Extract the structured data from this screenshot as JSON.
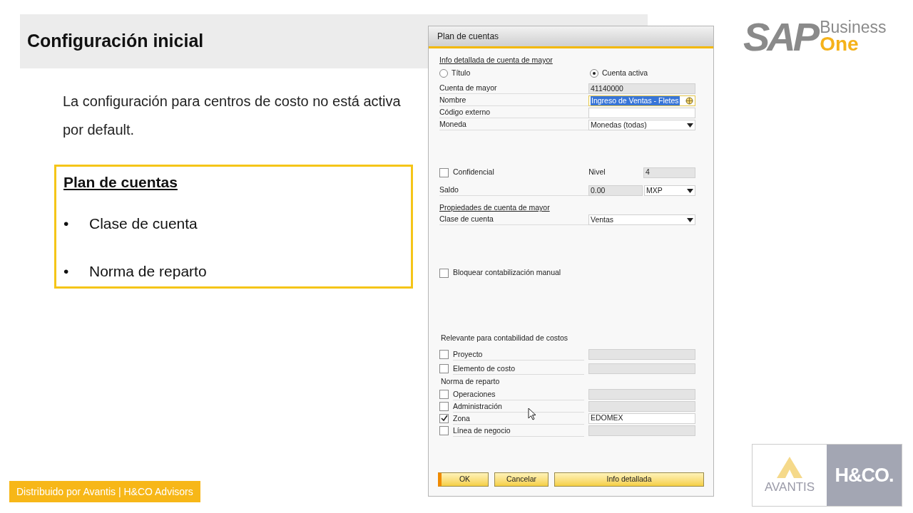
{
  "slide": {
    "title": "Configuración inicial",
    "paragraph": "La configuración para centros de costo no está activa por default.",
    "box": {
      "heading": "Plan de cuentas",
      "bullets": [
        {
          "marker": "•",
          "text": "Clase de cuenta"
        },
        {
          "marker": "•",
          "text": "Norma de reparto"
        }
      ]
    },
    "footer": "Distribuido por Avantis | H&CO Advisors",
    "logo_top": {
      "mark": "SAP",
      "line1": "Business",
      "line2": "One"
    },
    "logo_bottom": {
      "left": "AVANTIS",
      "right": "H&CO."
    }
  },
  "dialog": {
    "title": "Plan de cuentas",
    "section1": "Info detallada de cuenta de mayor",
    "radios": [
      {
        "label": "Título",
        "selected": false
      },
      {
        "label": "Cuenta activa",
        "selected": true
      }
    ],
    "fields": [
      {
        "label": "Cuenta de mayor",
        "value": "41140000",
        "kind": "readonly"
      },
      {
        "label": "Nombre",
        "value": "Ingreso de Ventas - Fletes",
        "kind": "highlighted"
      },
      {
        "label": "Código externo",
        "kind": "text"
      },
      {
        "label": "Moneda",
        "value": "Monedas (todas)",
        "kind": "dropdown"
      }
    ],
    "confidential": {
      "label": "Confidencial",
      "checked": false
    },
    "level": {
      "label": "Nivel",
      "value": "4"
    },
    "balance": {
      "label": "Saldo",
      "value": "0.00",
      "currency": "MXP"
    },
    "section2": "Propiedades de cuenta de mayor",
    "account_class": {
      "label": "Clase de cuenta",
      "value": "Ventas"
    },
    "block": {
      "label": "Bloquear contabilización manual",
      "checked": false
    },
    "cost_heading": "Relevante para contabilidad de costos",
    "cost_items": [
      {
        "label": "Proyecto",
        "checked": false
      },
      {
        "label": "Elemento de costo",
        "checked": false
      }
    ],
    "norm_heading": "Norma de reparto",
    "norm_items": [
      {
        "label": "Operaciones",
        "checked": false
      },
      {
        "label": "Administración",
        "checked": false
      },
      {
        "label": "Zona",
        "checked": true,
        "value": "EDOMEX"
      },
      {
        "label": "Línea de negocio",
        "checked": false
      }
    ],
    "buttons": [
      {
        "label": "OK",
        "selected": true
      },
      {
        "label": "Cancelar",
        "selected": false
      },
      {
        "label": "Info detallada",
        "selected": false
      }
    ]
  }
}
